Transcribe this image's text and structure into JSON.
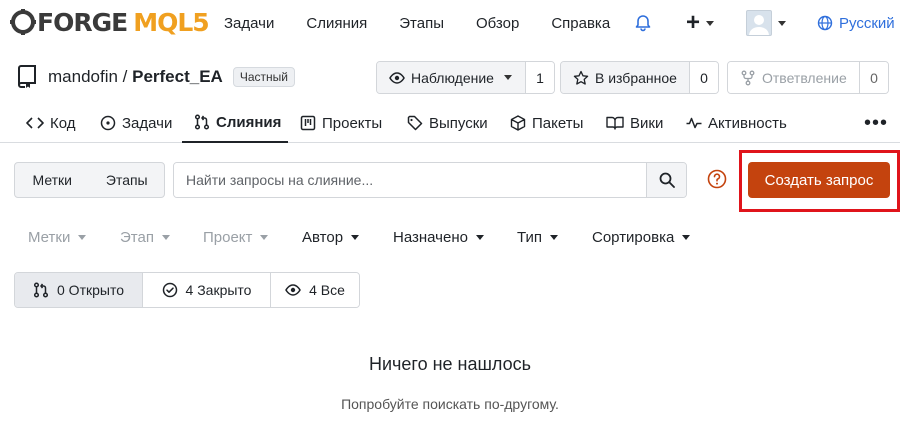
{
  "logo": {
    "part1": "FORGE",
    "part2": "MQL5"
  },
  "topnav": {
    "links": [
      "Задачи",
      "Слияния",
      "Этапы",
      "Обзор",
      "Справка"
    ],
    "plus_label": "+",
    "language": "Русский"
  },
  "repo": {
    "owner": "mandofin",
    "separator": " / ",
    "name": "Perfect_EA",
    "visibility": "Частный",
    "watch_label": "Наблюдение",
    "watch_count": "1",
    "star_label": "В избранное",
    "star_count": "0",
    "fork_label": "Ответвление",
    "fork_count": "0"
  },
  "tabs": {
    "code": "Код",
    "issues": "Задачи",
    "pulls": "Слияния",
    "projects": "Проекты",
    "releases": "Выпуски",
    "packages": "Пакеты",
    "wiki": "Вики",
    "activity": "Активность",
    "more": "•••"
  },
  "toolbar": {
    "labels_button": "Метки",
    "milestones_button": "Этапы",
    "search_placeholder": "Найти запросы на слияние...",
    "create_button": "Создать запрос"
  },
  "filters": {
    "labels": "Метки",
    "milestone": "Этап",
    "project": "Проект",
    "author": "Автор",
    "assignee": "Назначено",
    "type": "Тип",
    "sort": "Сортировка"
  },
  "states": {
    "open": "0 Открыто",
    "closed": "4 Закрыто",
    "all": "4 Все"
  },
  "empty": {
    "title": "Ничего не нашлось",
    "subtitle": "Попробуйте поискать по-другому."
  },
  "colors": {
    "accent": "#c4430e",
    "highlight": "#e0141b",
    "link": "#2f6fdc"
  }
}
